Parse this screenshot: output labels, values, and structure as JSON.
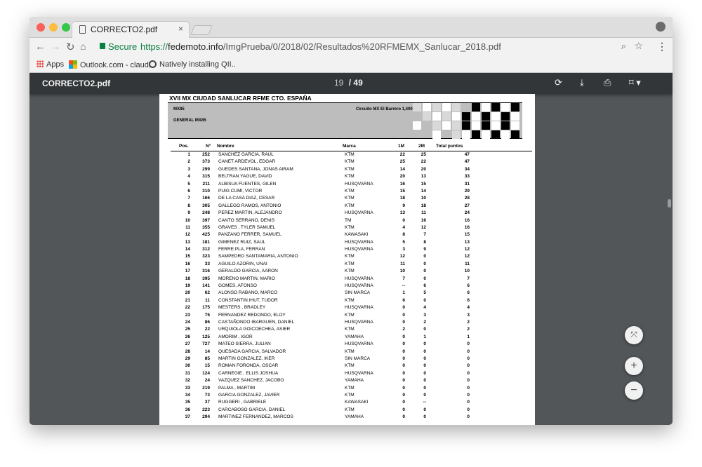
{
  "browser": {
    "tab_title": "CORRECTO2.pdf",
    "tab_close": "×",
    "secure_label": "Secure",
    "url_scheme": "https://",
    "url_host": "fedemoto.info",
    "url_path": "/ImgPrueba/0/2018/02/Resultados%20RFMEMX_Sanlucar_2018.pdf",
    "bookmarks": [
      "Apps",
      "Outlook.com - claudi..",
      "Natively installing QII.."
    ]
  },
  "pdf_toolbar": {
    "title": "CORRECTO2.pdf",
    "current_page": "19",
    "separator": "/",
    "total_pages": "49"
  },
  "document": {
    "title": "XVII MX CIUDAD SANLUCAR RFME CTO. ESPAÑA",
    "category": "MX85",
    "classification": "GENERAL MX85",
    "circuit": "Circuito MX El Barrero 1,400 km",
    "columns": {
      "pos": "Pos.",
      "num": "N°",
      "name": "Nombre",
      "brand": "Marca",
      "m1": "1M",
      "m2": "2M",
      "total": "Total puntos"
    },
    "rows": [
      [
        "1",
        "252",
        "SANCHEZ GARCIA, RAUL",
        "KTM",
        "22",
        "25",
        "47"
      ],
      [
        "2",
        "373",
        "CANET ARDEVOL, EDGAR",
        "KTM",
        "25",
        "22",
        "47"
      ],
      [
        "3",
        "299",
        "GUEDES SANTANA, JONAS AIRAM",
        "KTM",
        "14",
        "20",
        "34"
      ],
      [
        "4",
        "315",
        "BELTRAN YAGUE, DAVID",
        "KTM",
        "20",
        "13",
        "33"
      ],
      [
        "5",
        "211",
        "ALBISUA FUENTES, GILEN",
        "HUSQVARNA",
        "16",
        "15",
        "31"
      ],
      [
        "6",
        "310",
        "PUIG CUMI, VICTOR",
        "KTM",
        "15",
        "14",
        "29"
      ],
      [
        "7",
        "166",
        "DE LA CASA DIAZ, CESAR",
        "KTM",
        "18",
        "10",
        "28"
      ],
      [
        "8",
        "305",
        "GALLEGO RAMOS, ANTONIO",
        "KTM",
        "9",
        "18",
        "27"
      ],
      [
        "9",
        "248",
        "PEREZ MARTIN, ALEJANDRO",
        "HUSQVARNA",
        "13",
        "11",
        "24"
      ],
      [
        "10",
        "397",
        "CANTO SERRANO, DENIS",
        "TM",
        "0",
        "16",
        "16"
      ],
      [
        "11",
        "355",
        "GRAVES , TYLER SAMUEL",
        "KTM",
        "4",
        "12",
        "16"
      ],
      [
        "12",
        "425",
        "PANZANO FERRER, SAMUEL",
        "KAWASAKI",
        "8",
        "7",
        "15"
      ],
      [
        "13",
        "181",
        "GIMENEZ RUIZ, SAUL",
        "HUSQVARNA",
        "5",
        "8",
        "13"
      ],
      [
        "14",
        "312",
        "FERRE PLA, FERRAN",
        "HUSQVARNA",
        "3",
        "9",
        "12"
      ],
      [
        "15",
        "323",
        "SAMPEDRO SANTAMARIA, ANTONIO",
        "KTM",
        "12",
        "0",
        "12"
      ],
      [
        "16",
        "33",
        "AGUILO AZORIN, UNAI",
        "KTM",
        "11",
        "0",
        "11"
      ],
      [
        "17",
        "316",
        "GERALDO GARCIA, AARON",
        "KTM",
        "10",
        "0",
        "10"
      ],
      [
        "18",
        "395",
        "MORENO MARTIN, MARIO",
        "HUSQVARNA",
        "7",
        "0",
        "7"
      ],
      [
        "19",
        "141",
        "GOMES, AFONSO",
        "HUSQVARNA",
        "--",
        "6",
        "6"
      ],
      [
        "20",
        "62",
        "ALONSO RABANO, MARCO",
        "SIN MARCA",
        "1",
        "5",
        "6"
      ],
      [
        "21",
        "11",
        "CONSTANTIN IHUT, TUDOR",
        "KTM",
        "6",
        "0",
        "6"
      ],
      [
        "22",
        "175",
        "MESTERS , BRADLEY",
        "HUSQVARNA",
        "0",
        "4",
        "4"
      ],
      [
        "23",
        "75",
        "FERNANDEZ REDONDO, ELOY",
        "KTM",
        "0",
        "3",
        "3"
      ],
      [
        "24",
        "86",
        "CASTAÑONDO IBARGUEN, DANIEL",
        "HUSQVARNA",
        "0",
        "2",
        "2"
      ],
      [
        "25",
        "22",
        "URQUIOLA GOICOECHEA, ASIER",
        "KTM",
        "2",
        "0",
        "2"
      ],
      [
        "26",
        "125",
        "AMORIM , IGOR",
        "YAMAHA",
        "0",
        "1",
        "1"
      ],
      [
        "27",
        "727",
        "MATEO SIERRA, JULIAN",
        "HUSQVARNA",
        "0",
        "0",
        "0"
      ],
      [
        "28",
        "14",
        "QUESADA GARCIA, SALVADOR",
        "KTM",
        "0",
        "0",
        "0"
      ],
      [
        "29",
        "85",
        "MARTIN GONZALEZ, IKER",
        "SIN MARCA",
        "0",
        "0",
        "0"
      ],
      [
        "30",
        "15",
        "ROMAN FORONDA, OSCAR",
        "KTM",
        "0",
        "0",
        "0"
      ],
      [
        "31",
        "124",
        "CARNEGIE , ELLIS JOSHUA",
        "HUSQVARNA",
        "0",
        "0",
        "0"
      ],
      [
        "32",
        "24",
        "VAZQUEZ SANCHEZ, JACOBO",
        "YAMAHA",
        "0",
        "0",
        "0"
      ],
      [
        "33",
        "219",
        "PALMA , MARTIM",
        "KTM",
        "0",
        "0",
        "0"
      ],
      [
        "34",
        "73",
        "GARCIA GONZALEZ, JAVIER",
        "KTM",
        "0",
        "0",
        "0"
      ],
      [
        "35",
        "37",
        "RUGGERI , GABRIELE",
        "KAWASAKI",
        "0",
        "--",
        "0"
      ],
      [
        "36",
        "223",
        "CARCABOSO GARCIA, DANIEL",
        "KTM",
        "0",
        "0",
        "0"
      ],
      [
        "37",
        "294",
        "MARTINEZ FERNANDEZ, MARCOS",
        "YAMAHA",
        "0",
        "0",
        "0"
      ]
    ]
  },
  "controls": {
    "fit": "⤧",
    "zoom_in": "+",
    "zoom_out": "−"
  },
  "colors": {
    "pdf_toolbar": "#323639",
    "viewer_bg": "#525659",
    "secure_green": "#0b8043"
  }
}
